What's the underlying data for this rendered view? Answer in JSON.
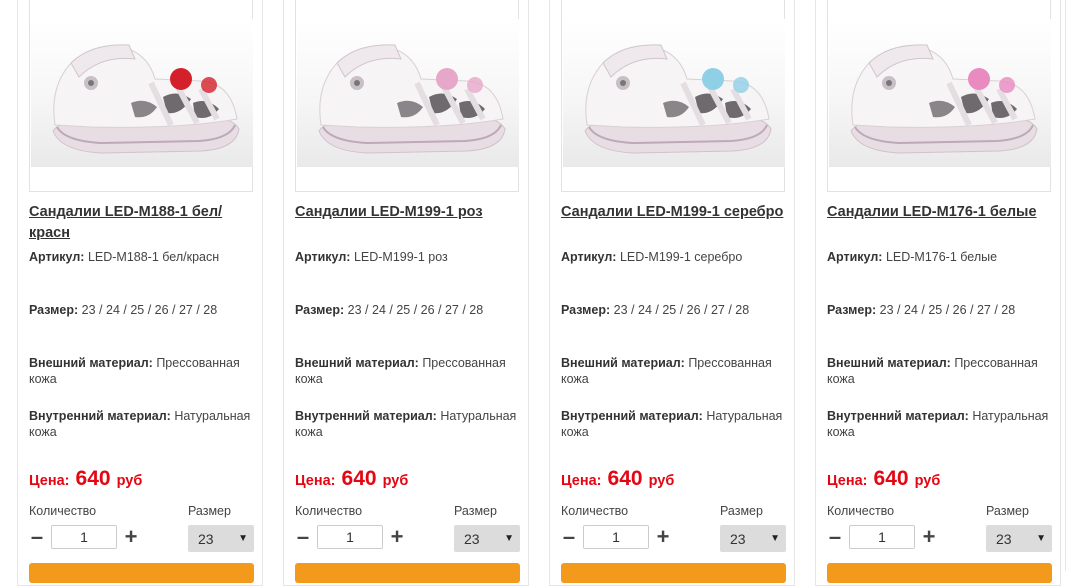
{
  "products": [
    {
      "name": "Сандалии LED-M188-1 бел/красн",
      "sku_label": "Артикул:",
      "sku": "LED-M188-1 бел/красн",
      "size_label": "Размер:",
      "sizes": "23 / 24 / 25 / 26 / 27 / 28",
      "outer_label": "Внешний материал:",
      "outer": "Прессованная кожа",
      "inner_label": "Внутренний материал:",
      "inner": "Натуральная кожа",
      "price_label": "Цена:",
      "price": "640",
      "currency": "руб",
      "qty_label": "Количество",
      "qty": "1",
      "size_select_label": "Размер",
      "size_selected": "23",
      "accent": "#d3202a"
    },
    {
      "name": "Сандалии LED-M199-1 роз",
      "sku_label": "Артикул:",
      "sku": "LED-M199-1 роз",
      "size_label": "Размер:",
      "sizes": "23 / 24 / 25 / 26 / 27 / 28",
      "outer_label": "Внешний материал:",
      "outer": "Прессованная кожа",
      "inner_label": "Внутренний материал:",
      "inner": "Натуральная кожа",
      "price_label": "Цена:",
      "price": "640",
      "currency": "руб",
      "qty_label": "Количество",
      "qty": "1",
      "size_select_label": "Размер",
      "size_selected": "23",
      "accent": "#e7a7c9"
    },
    {
      "name": "Сандалии LED-M199-1 серебро",
      "sku_label": "Артикул:",
      "sku": "LED-M199-1 серебро",
      "size_label": "Размер:",
      "sizes": "23 / 24 / 25 / 26 / 27 / 28",
      "outer_label": "Внешний материал:",
      "outer": "Прессованная кожа",
      "inner_label": "Внутренний материал:",
      "inner": "Натуральная кожа",
      "price_label": "Цена:",
      "price": "640",
      "currency": "руб",
      "qty_label": "Количество",
      "qty": "1",
      "size_select_label": "Размер",
      "size_selected": "23",
      "accent": "#8fd0e6"
    },
    {
      "name": "Сандалии LED-M176-1 белые",
      "sku_label": "Артикул:",
      "sku": "LED-M176-1 белые",
      "size_label": "Размер:",
      "sizes": "23 / 24 / 25 / 26 / 27 / 28",
      "outer_label": "Внешний материал:",
      "outer": "Прессованная кожа",
      "inner_label": "Внутренний материал:",
      "inner": "Натуральная кожа",
      "price_label": "Цена:",
      "price": "640",
      "currency": "руб",
      "qty_label": "Количество",
      "qty": "1",
      "size_select_label": "Размер",
      "size_selected": "23",
      "accent": "#e98ac0"
    }
  ],
  "icons": {
    "minus": "minus-icon",
    "plus": "plus-icon",
    "dropdown": "chevron-down-icon"
  },
  "colors": {
    "price": "#e30613",
    "buy_button": "#f39a1c"
  }
}
